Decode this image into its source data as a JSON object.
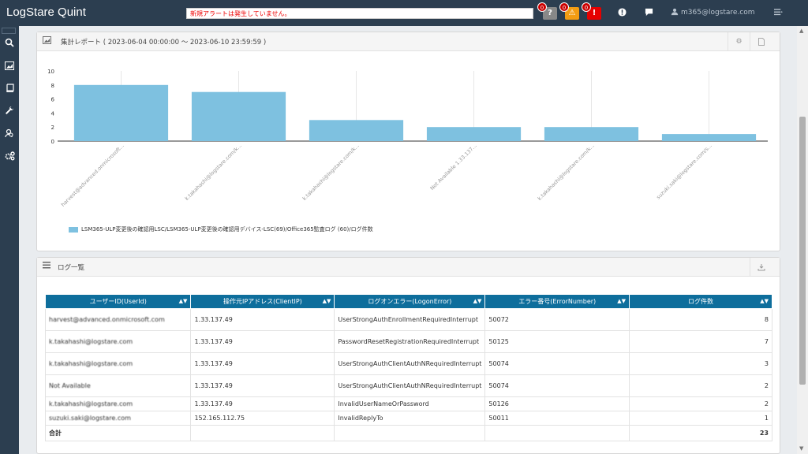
{
  "app": {
    "title": "LogStare Quint",
    "alert_text": "新規アラートは発生していません。",
    "user": "m365@logstare.com",
    "badges": [
      {
        "count": "0",
        "symbol": "?",
        "color": "#888888"
      },
      {
        "count": "0",
        "symbol": "⚠",
        "color": "#f39c12"
      },
      {
        "count": "0",
        "symbol": "!",
        "color": "#e60000"
      }
    ]
  },
  "report": {
    "title": "集計レポート ( 2023-06-04 00:00:00 ～ 2023-06-10 23:59:59 )",
    "legend": "LSM365-ULP変更後の確認用LSC/LSM365-ULP変更後の確認用デバイス-LSC(69)/Office365監査ログ (60)/ログ件数"
  },
  "chart_data": {
    "type": "bar",
    "categories": [
      "harvest@advanced.onmicrosoft...",
      "k.takahashi@logstare.com/k...",
      "k.takahashi@logstare.com/k...",
      "Not Available 1.33.137...",
      "k.takahashi@logstare.com/k...",
      "suzuki.saki@logstare.com/s..."
    ],
    "series": [
      {
        "values": [
          8,
          7,
          3,
          2,
          2,
          1
        ]
      }
    ],
    "yticks": [
      "10",
      "8",
      "6",
      "4",
      "2",
      "0"
    ],
    "ylim": [
      0,
      10
    ],
    "color": "#7ec1e0",
    "grid": true,
    "legend_position": "bottom-left"
  },
  "logs": {
    "title": "ログ一覧",
    "columns": [
      "ユーザーID(UserId)",
      "操作元IPアドレス(ClientIP)",
      "ログオンエラー(LogonError)",
      "エラー番号(ErrorNumber)",
      "ログ件数"
    ],
    "rows": [
      {
        "user": "harvest@advanced.onmicrosoft.com",
        "ip": "1.33.137.49",
        "error": "UserStrongAuthEnrollmentRequiredInterrupt",
        "number": "50072",
        "count": "8"
      },
      {
        "user": "k.takahashi@logstare.com",
        "ip": "1.33.137.49",
        "error": "PasswordResetRegistrationRequiredInterrupt",
        "number": "50125",
        "count": "7"
      },
      {
        "user": "k.takahashi@logstare.com",
        "ip": "1.33.137.49",
        "error": "UserStrongAuthClientAuthNRequiredInterrupt",
        "number": "50074",
        "count": "3"
      },
      {
        "user": "Not Available",
        "ip": "1.33.137.49",
        "error": "UserStrongAuthClientAuthNRequiredInterrupt",
        "number": "50074",
        "count": "2"
      },
      {
        "user": "k.takahashi@logstare.com",
        "ip": "1.33.137.49",
        "error": "InvalidUserNameOrPassword",
        "number": "50126",
        "count": "2"
      },
      {
        "user": "suzuki.saki@logstare.com",
        "ip": "152.165.112.75",
        "error": "InvalidReplyTo",
        "number": "50011",
        "count": "1"
      }
    ],
    "total_label": "合計",
    "total_value": "23"
  },
  "icons": {
    "sidebar": [
      "search-icon",
      "report-icon",
      "book-icon",
      "wrench-icon",
      "users-icon",
      "gears-icon"
    ],
    "topbar": [
      "alert-icon",
      "chat-icon",
      "user-icon",
      "menu-icon"
    ]
  }
}
